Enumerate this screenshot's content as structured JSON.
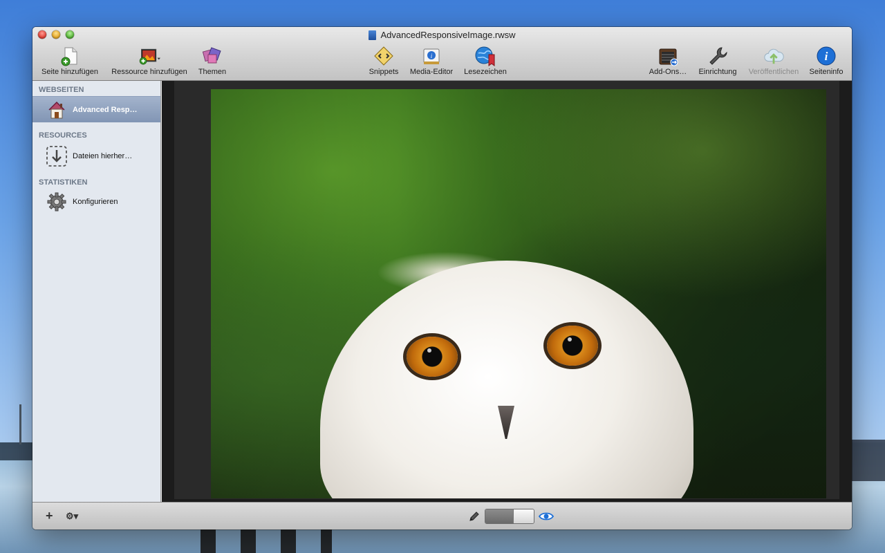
{
  "window": {
    "title": "AdvancedResponsiveImage.rwsw"
  },
  "toolbar": {
    "left": [
      {
        "label": "Seite hinzufügen",
        "icon": "add-page-icon"
      },
      {
        "label": "Ressource hinzufügen",
        "icon": "add-resource-icon"
      },
      {
        "label": "Themen",
        "icon": "themes-icon"
      }
    ],
    "center": [
      {
        "label": "Snippets",
        "icon": "snippets-icon"
      },
      {
        "label": "Media-Editor",
        "icon": "media-editor-icon"
      },
      {
        "label": "Lesezeichen",
        "icon": "bookmarks-icon"
      }
    ],
    "right": [
      {
        "label": "Add-Ons…",
        "icon": "addons-icon"
      },
      {
        "label": "Einrichtung",
        "icon": "wrench-icon"
      },
      {
        "label": "Veröffentlichen",
        "icon": "publish-cloud-icon",
        "disabled": true
      },
      {
        "label": "Seiteninfo",
        "icon": "info-icon"
      }
    ]
  },
  "sidebar": {
    "sections": [
      {
        "header": "WEBSEITEN",
        "items": [
          {
            "label": "Advanced Resp…",
            "icon": "house-icon",
            "selected": true
          }
        ]
      },
      {
        "header": "RESOURCES",
        "items": [
          {
            "label": "Dateien hierher…",
            "icon": "drop-files-icon"
          }
        ]
      },
      {
        "header": "STATISTIKEN",
        "items": [
          {
            "label": "Konfigurieren",
            "icon": "gear-icon"
          }
        ]
      }
    ]
  },
  "bottombar": {
    "add_label": "+",
    "settings_label": "⚙▾"
  },
  "colors": {
    "selection": "#8195b4",
    "accent_blue": "#1d6fd6"
  }
}
